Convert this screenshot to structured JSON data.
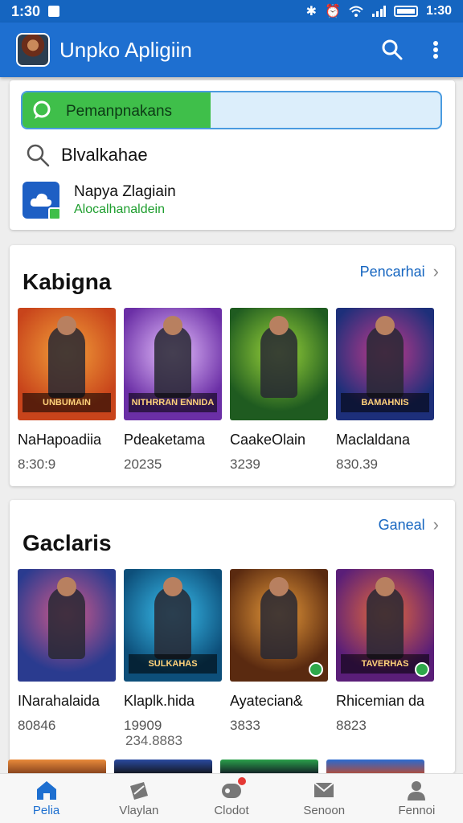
{
  "status_bar": {
    "time_left": "1:30",
    "time_right": "1:30"
  },
  "app_bar": {
    "title": "Unpko Apligiin",
    "avatar_icon": "game-hero-avatar",
    "search_icon": "search-icon",
    "menu_icon": "more-vertical-icon"
  },
  "search_card": {
    "progress_label": "Pemanpnakans",
    "progress_fraction": 0.45,
    "search_text": "Blvalkahae",
    "suggestion": {
      "title": "Napya Zlagiain",
      "subtitle": "Alocalhanaldein"
    }
  },
  "sections": [
    {
      "title": "Kabigna",
      "link": "Pencarhai",
      "items": [
        {
          "name": "NaHapoadiia",
          "count": "8:30:9",
          "banner": "UNBUMAIN",
          "colors": [
            "#c8441b",
            "#f3a13a"
          ],
          "badge": false
        },
        {
          "name": "Pdeaketama",
          "count": "20235",
          "banner": "NITHRRAN ENNIDA",
          "colors": [
            "#6b2fa6",
            "#e8c2ff"
          ],
          "badge": false
        },
        {
          "name": "CaakeOlain",
          "count": "3239",
          "banner": "",
          "colors": [
            "#1f5b20",
            "#9cd63a"
          ],
          "badge": false
        },
        {
          "name": "Maclaldana",
          "count": "830.39",
          "banner": "BAMAHNIS",
          "colors": [
            "#1d2f7a",
            "#c43a8a"
          ],
          "badge": false
        }
      ]
    },
    {
      "title": "Gaclaris",
      "link": "Ganeal",
      "items": [
        {
          "name": "INarahalaida",
          "count": "80846",
          "banner": "",
          "colors": [
            "#2a3b8f",
            "#d45a8a"
          ],
          "badge": false
        },
        {
          "name": "Klaplk.hida",
          "count": "19909",
          "banner": "SULKAHAS",
          "colors": [
            "#0d4f7a",
            "#3ac0f0"
          ],
          "badge": false
        },
        {
          "name": "Ayatecian&",
          "count": "3833",
          "banner": "",
          "colors": [
            "#5a2a10",
            "#e89a3a"
          ],
          "badge": true
        },
        {
          "name": "Rhicemian da",
          "count": "8823",
          "banner": "TAVERHAS",
          "colors": [
            "#5a1e78",
            "#e86a3a"
          ],
          "badge": true
        }
      ],
      "extra_count": "234.8883"
    }
  ],
  "bottom_nav": [
    {
      "label": "Pelia",
      "icon": "home-icon",
      "active": true
    },
    {
      "label": "Vlaylan",
      "icon": "tag-icon",
      "active": false
    },
    {
      "label": "Clodot",
      "icon": "gamepad-icon",
      "active": false,
      "notification": true
    },
    {
      "label": "Senoon",
      "icon": "mail-icon",
      "active": false
    },
    {
      "label": "Fennoi",
      "icon": "profile-icon",
      "active": false
    }
  ],
  "colors": {
    "primary": "#1e6fd0",
    "accent_green": "#3fbf4a",
    "link_blue": "#1565c0"
  }
}
